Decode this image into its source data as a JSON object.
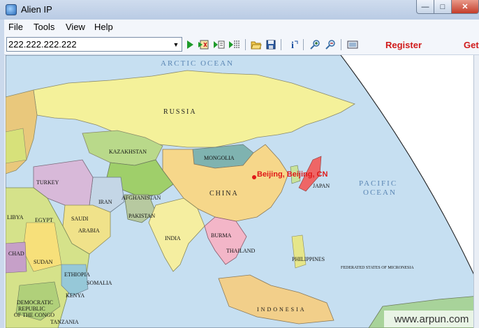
{
  "window": {
    "title": "Alien IP",
    "min_glyph": "—",
    "max_glyph": "□",
    "close_glyph": "✕"
  },
  "menu": {
    "items": [
      "File",
      "Tools",
      "View",
      "Help"
    ]
  },
  "toolbar": {
    "ip_value": "222.222.222.222",
    "register_label": "Register",
    "get_label": "Get"
  },
  "map": {
    "location_label": "Beijing, Beijing, CN",
    "oceans": {
      "arctic": "ARCTIC OCEAN",
      "pacific_1": "PACIFIC",
      "pacific_2": "OCEAN"
    },
    "major_labels": {
      "russia": "RUSSIA",
      "china": "CHINA"
    },
    "country_labels": {
      "kazakhstan": "KAZAKHSTAN",
      "mongolia": "MONGOLIA",
      "iran": "IRAN",
      "india": "INDIA",
      "saudi": "SAUDI",
      "arabia": "ARABIA",
      "egypt": "EGYPT",
      "sudan": "SUDAN",
      "chad": "CHAD",
      "ethiopia": "ETHIOPIA",
      "turkey": "TURKEY",
      "japan": "JAPAN",
      "pakistan": "PAKISTAN",
      "libya": "LIBYA",
      "afghanistan": "AFGHANISTAN",
      "burma": "BURMA",
      "thailand": "THAILAND",
      "philippines": "PHILIPPINES",
      "somalia": "SOMALIA",
      "kenya": "KENYA",
      "congo_1": "DEMOCRATIC",
      "congo_2": "REPUBLIC",
      "congo_3": "OF THE CONGO",
      "tanzania": "TANZANIA",
      "indonesia": "INDONESIA",
      "micronesia": "FEDERATED STATES OF MICRONESIA"
    },
    "watermark": "www.arpun.com"
  },
  "colors": {
    "location": "#e01818",
    "register": "#d01a1a",
    "ocean_label": "#5a86b4"
  }
}
